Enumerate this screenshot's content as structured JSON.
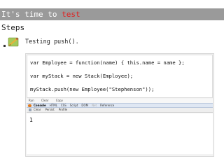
{
  "slide": {
    "title_prefix": "It's time to ",
    "title_accent": "test",
    "subtitle": "Steps",
    "bullet_text": "Testing push()."
  },
  "code": {
    "lines": [
      "var Employee = function(name) { this.name = name };",
      "var myStack = new Stack(Employee);",
      "myStack.push(new Employee(\"Stephenson\"));"
    ]
  },
  "firebug": {
    "menu": [
      "Run",
      "Clear",
      "Copy"
    ],
    "tabs": [
      "Console",
      "HTML",
      "CSS",
      "Script",
      "DOM",
      "Net",
      "Reference"
    ],
    "subbar": [
      "Clear",
      "Persist",
      "Profile"
    ]
  },
  "console": {
    "output": "1"
  },
  "colors": {
    "title_bar": "#9a9a9a",
    "accent": "#e02020",
    "firebug_tab_bar": "#dfe7f3"
  },
  "icons": {
    "bullet": "pencil-icon",
    "firebug": "firebug-bug-icon"
  }
}
